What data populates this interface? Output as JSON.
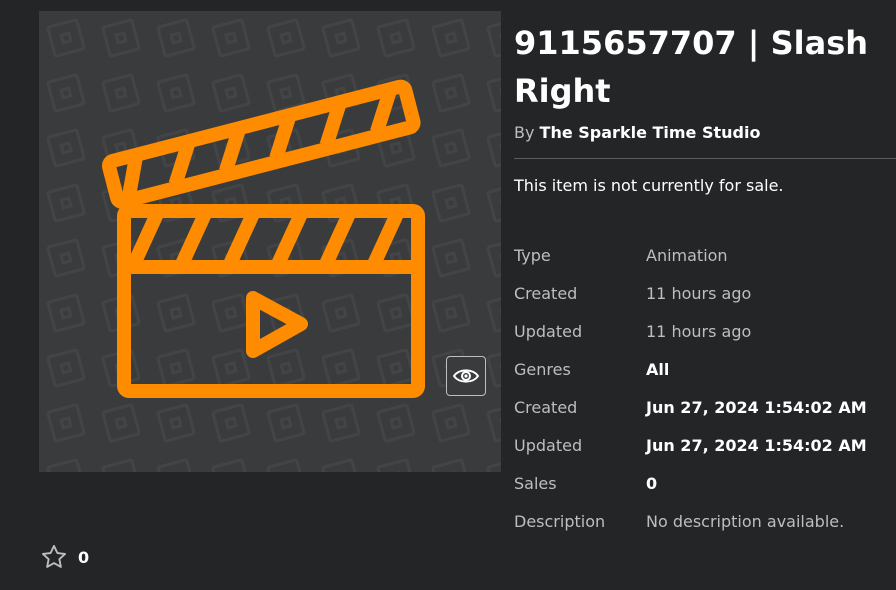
{
  "item": {
    "title": "9115657707 | Slash Right",
    "by_prefix": "By",
    "creator": "The Sparkle Time Studio",
    "sale_status": "This item is not currently for sale."
  },
  "favorites": {
    "count": "0"
  },
  "details": [
    {
      "label": "Type",
      "value": "Animation",
      "strong": false
    },
    {
      "label": "Created",
      "value": "11 hours ago",
      "strong": false
    },
    {
      "label": "Updated",
      "value": "11 hours ago",
      "strong": false
    },
    {
      "label": "Genres",
      "value": "All",
      "strong": true
    },
    {
      "label": "Created",
      "value": "Jun 27, 2024 1:54:02 AM",
      "strong": true
    },
    {
      "label": "Updated",
      "value": "Jun 27, 2024 1:54:02 AM",
      "strong": true
    },
    {
      "label": "Sales",
      "value": "0",
      "strong": true
    },
    {
      "label": "Description",
      "value": "No description available.",
      "strong": false
    }
  ],
  "icons": {
    "thumbnail": "clapperboard-icon",
    "preview": "eye-icon",
    "favorite": "star-outline-icon"
  },
  "colors": {
    "background": "#232527",
    "thumbnail_bg": "#393b3d",
    "accent": "#ff8c00",
    "muted_text": "#bdbebe"
  }
}
